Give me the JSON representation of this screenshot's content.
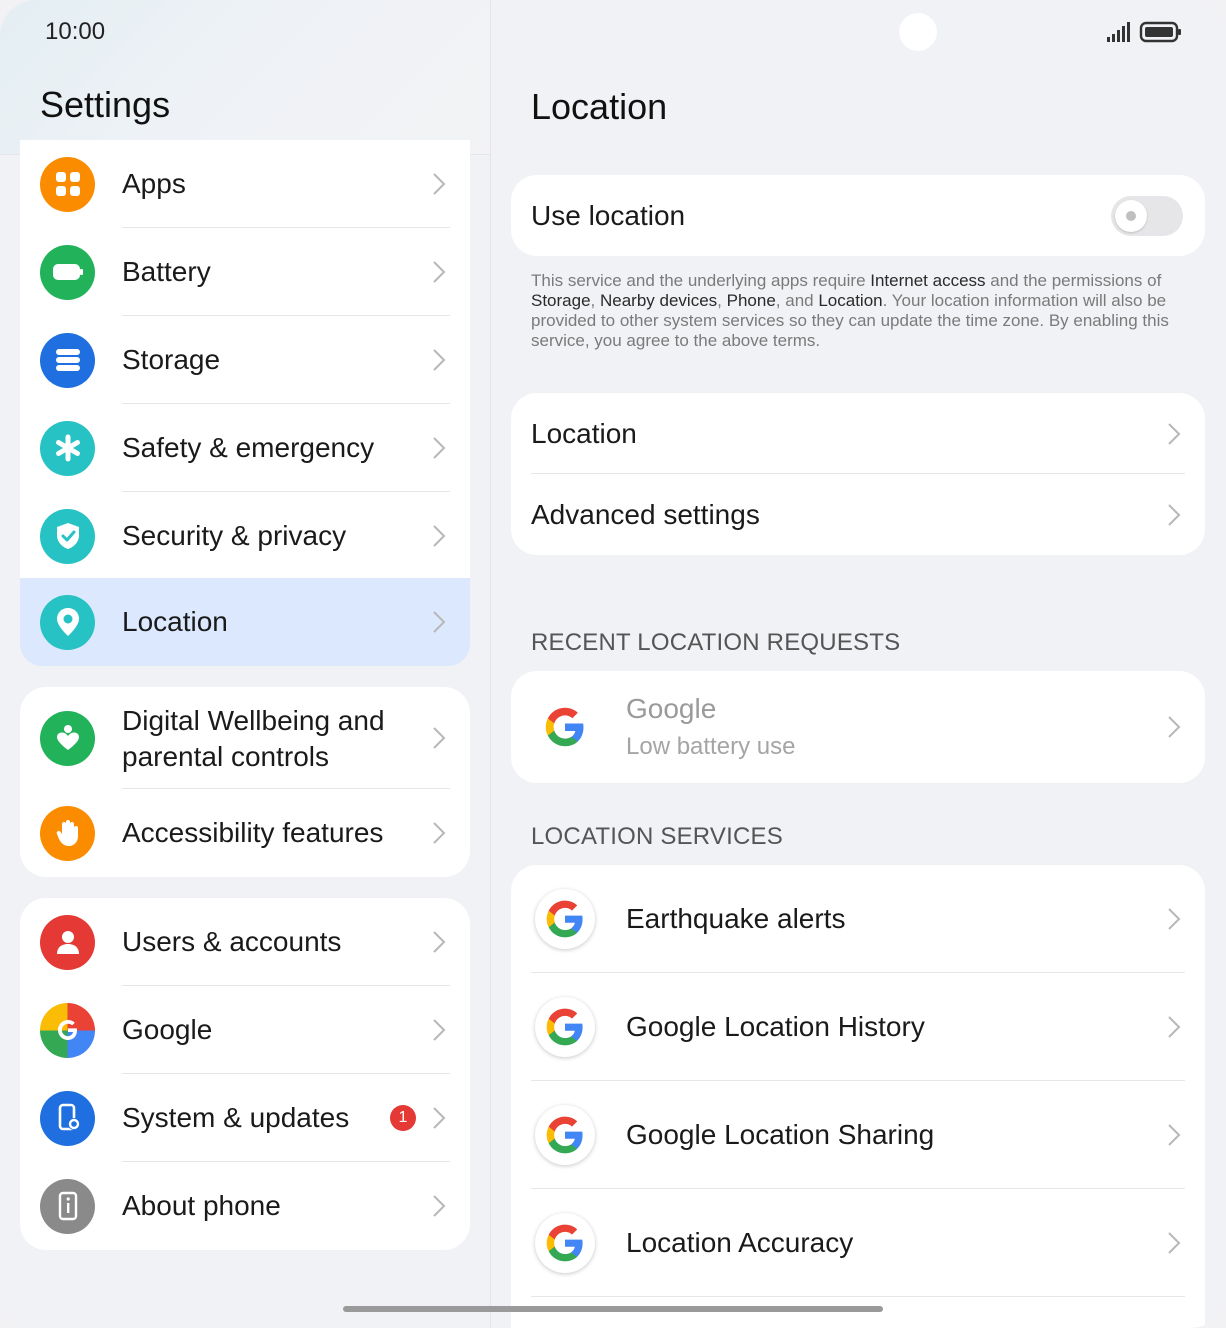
{
  "status_bar": {
    "time": "10:00"
  },
  "left": {
    "title": "Settings",
    "group1": [
      {
        "label": "Apps",
        "icon": "apps-icon",
        "color": "#fb8c00"
      },
      {
        "label": "Battery",
        "icon": "battery-icon",
        "color": "#22b35a"
      },
      {
        "label": "Storage",
        "icon": "storage-icon",
        "color": "#1f6fe0"
      },
      {
        "label": "Safety & emergency",
        "icon": "asterisk-icon",
        "color": "#27c2c3"
      },
      {
        "label": "Security & privacy",
        "icon": "shield-icon",
        "color": "#27c2c3"
      },
      {
        "label": "Location",
        "icon": "location-pin-icon",
        "color": "#27c2c3"
      }
    ],
    "group2": [
      {
        "label_line1": "Digital Wellbeing and",
        "label_line2": "parental controls",
        "icon": "wellbeing-icon",
        "color": "#22b35a"
      },
      {
        "label": "Accessibility features",
        "icon": "hand-icon",
        "color": "#fb8c00"
      }
    ],
    "group3": [
      {
        "label": "Users & accounts",
        "icon": "user-icon",
        "color": "#e53935"
      },
      {
        "label": "Google",
        "icon": "google-icon",
        "color": "#4285f4"
      },
      {
        "label": "System & updates",
        "icon": "phone-gear-icon",
        "color": "#1f6fe0",
        "badge": "1"
      },
      {
        "label": "About phone",
        "icon": "info-icon",
        "color": "#8a8a8a"
      }
    ]
  },
  "right": {
    "title": "Location",
    "use_location_label": "Use location",
    "use_location_on": false,
    "description": {
      "p1": "This service and the underlying apps require ",
      "b1": "Internet access",
      "p2": " and the permissions of ",
      "b2": "Storage",
      "p3": ", ",
      "b3": "Nearby devices",
      "p4": ", ",
      "b4": "Phone",
      "p5": ", and ",
      "b5": "Location",
      "p6": ". Your location information will also be provided to other system services so they can update the time zone. By enabling this service, you agree to the above terms."
    },
    "settings": [
      {
        "label": "Location"
      },
      {
        "label": "Advanced settings"
      }
    ],
    "recent_header": "RECENT LOCATION REQUESTS",
    "recent": {
      "title": "Google",
      "subtitle": "Low battery use"
    },
    "services_header": "LOCATION SERVICES",
    "services": [
      {
        "label": "Earthquake alerts"
      },
      {
        "label": "Google Location History"
      },
      {
        "label": "Google Location Sharing"
      },
      {
        "label": "Location Accuracy"
      }
    ]
  }
}
